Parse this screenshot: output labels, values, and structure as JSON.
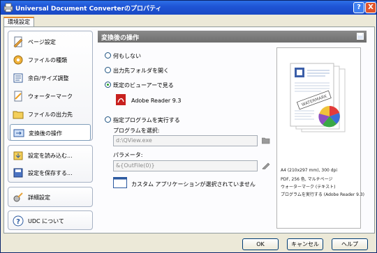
{
  "window": {
    "title": "Universal Document Converterのプロパティ",
    "help_btn": "?",
    "close_btn": "X"
  },
  "tab": {
    "label": "環境設定"
  },
  "sidebar": {
    "items": [
      {
        "label": "ページ設定",
        "icon": "page-setup-icon"
      },
      {
        "label": "ファイルの種類",
        "icon": "file-format-icon"
      },
      {
        "label": "余白/サイズ調整",
        "icon": "margins-icon"
      },
      {
        "label": "ウォーターマーク",
        "icon": "watermark-icon"
      },
      {
        "label": "ファイルの出力先",
        "icon": "output-location-icon"
      },
      {
        "label": "変換後の操作",
        "icon": "post-action-icon",
        "selected": true
      },
      {
        "label": "設定を読み込む...",
        "icon": "load-settings-icon"
      },
      {
        "label": "設定を保存する...",
        "icon": "save-settings-icon"
      },
      {
        "label": "詳細設定",
        "icon": "advanced-settings-icon"
      },
      {
        "label": "UDC について",
        "icon": "about-icon"
      }
    ]
  },
  "main": {
    "header": "変換後の操作",
    "options": [
      {
        "label": "何もしない",
        "checked": false
      },
      {
        "label": "出力先フォルダを開く",
        "checked": false
      },
      {
        "label": "既定のビューアーで見る",
        "checked": true
      },
      {
        "label": "指定プログラムを実行する",
        "checked": false
      }
    ],
    "viewer_app": "Adobe Reader 9.3",
    "program_label": "プログラムを選択:",
    "program_value": "d:\\QView.exe",
    "params_label": "パラメータ:",
    "params_value": "&{OutFile(0)}",
    "warning_text": "カスタム アプリケーションが選択されていません"
  },
  "preview": {
    "watermark_text": "WATERMARK",
    "info_lines": [
      "A4 (210x297 mm), 300 dpi",
      "PDF, 256 色, マルチページ",
      "ウォーターマーク (テキスト)",
      "プログラムを実行する (Adobe Reader 9.3)"
    ]
  },
  "buttons": {
    "ok": "OK",
    "cancel": "キャンセル",
    "help": "ヘルプ"
  },
  "colors": {
    "title_bar": "#1f55d6",
    "header_bar": "#7b7b7b",
    "selected_radio": "#21a121"
  }
}
